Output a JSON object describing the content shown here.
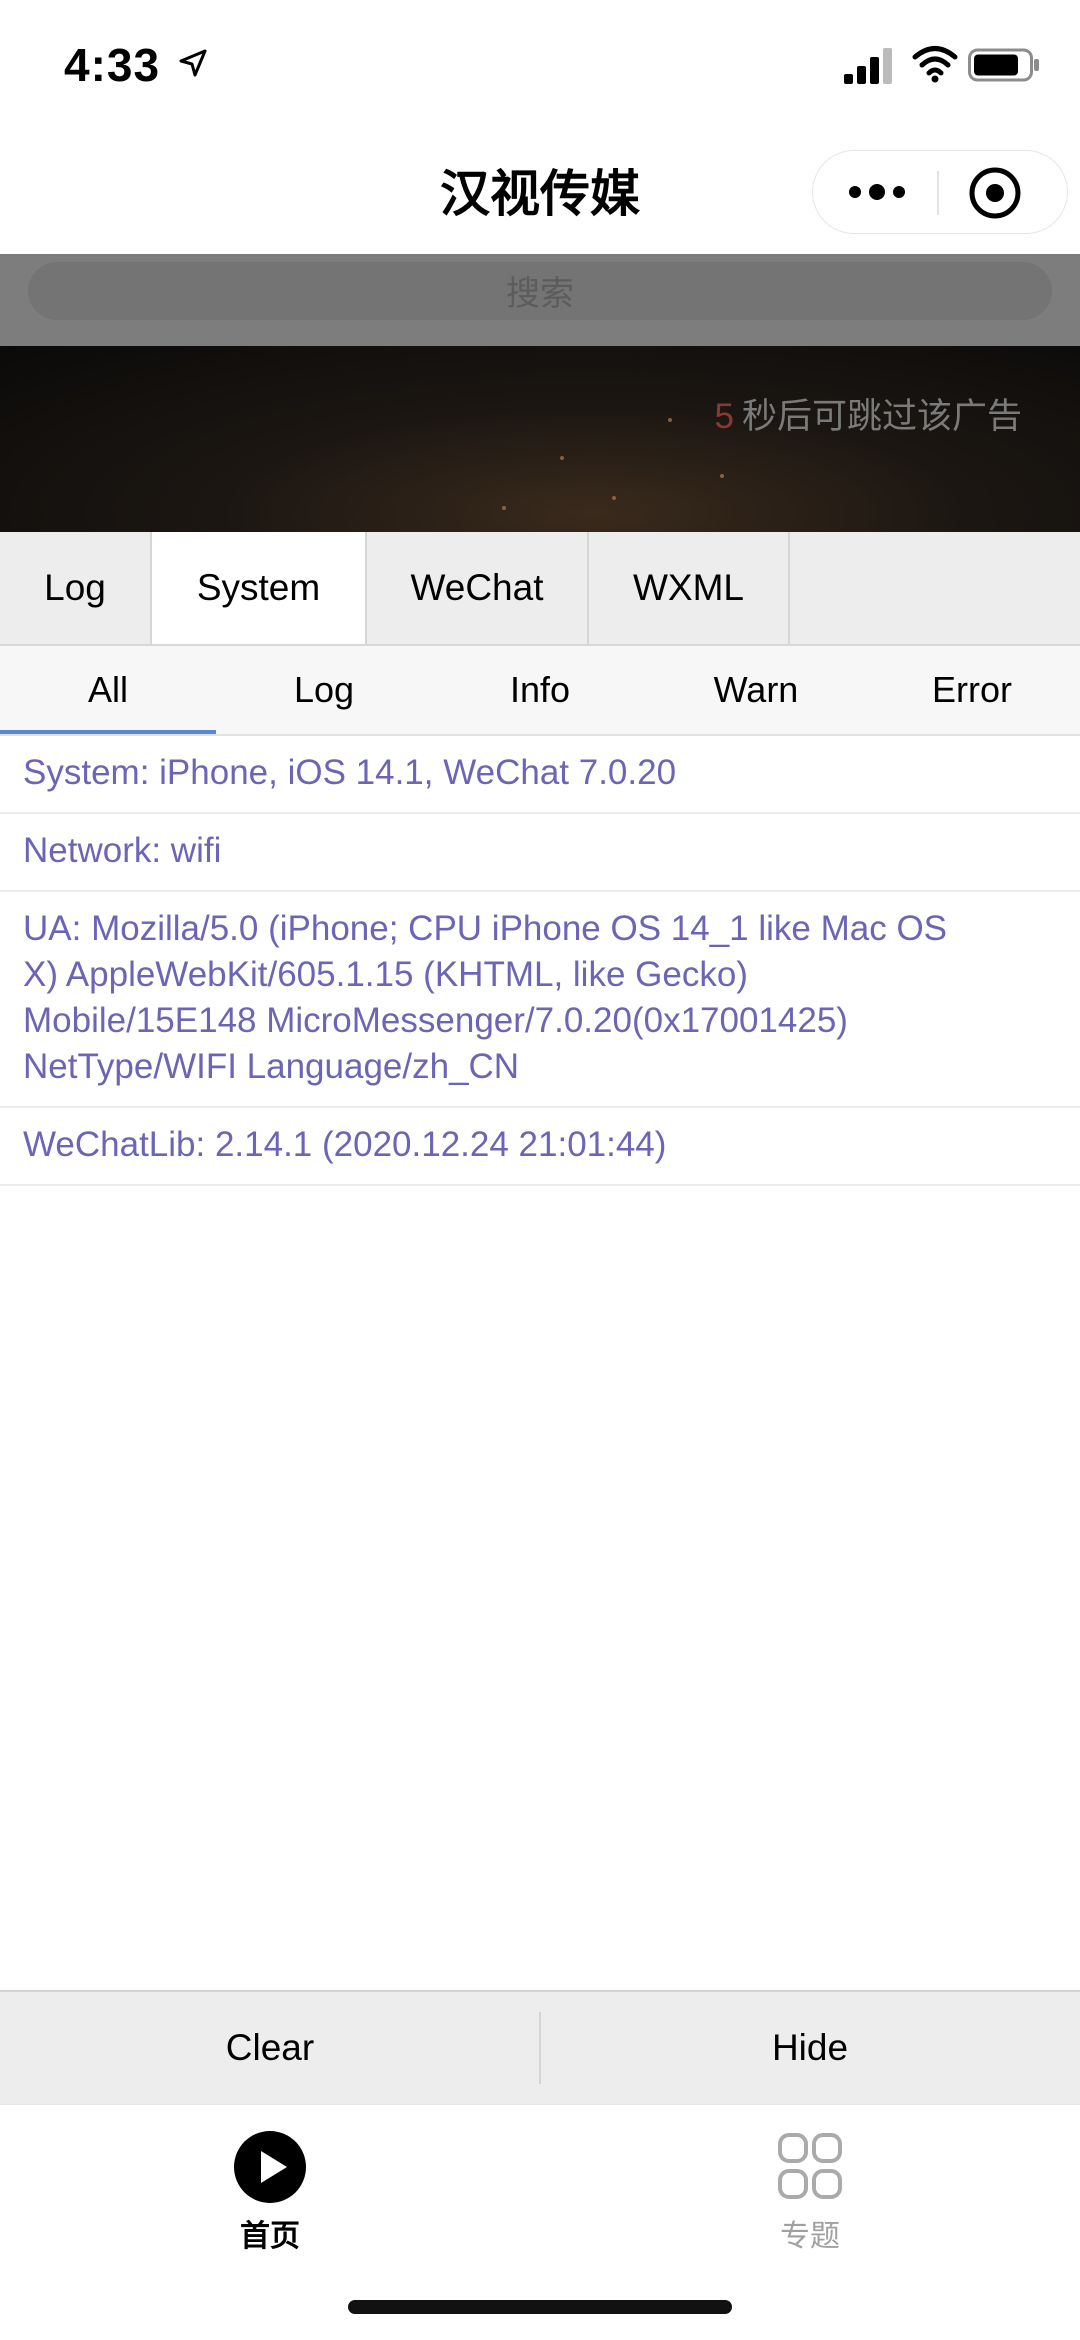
{
  "status_bar": {
    "time": "4:33"
  },
  "nav": {
    "title": "汉视传媒"
  },
  "search": {
    "placeholder": "搜索"
  },
  "ad": {
    "countdown": "5",
    "skip_text": "秒后可跳过该广告"
  },
  "vconsole": {
    "tabs": [
      {
        "label": "Log"
      },
      {
        "label": "System"
      },
      {
        "label": "WeChat"
      },
      {
        "label": "WXML"
      }
    ],
    "active_tab": "System",
    "subtabs": [
      {
        "label": "All"
      },
      {
        "label": "Log"
      },
      {
        "label": "Info"
      },
      {
        "label": "Warn"
      },
      {
        "label": "Error"
      }
    ],
    "active_subtab": "All",
    "logs": [
      "System: iPhone, iOS 14.1, WeChat 7.0.20",
      "Network: wifi",
      "UA: Mozilla/5.0 (iPhone; CPU iPhone OS 14_1 like Mac OS X) AppleWebKit/605.1.15 (KHTML, like Gecko) Mobile/15E148 MicroMessenger/7.0.20(0x17001425) NetType/WIFI Language/zh_CN",
      "WeChatLib: 2.14.1 (2020.12.24 21:01:44)"
    ],
    "footer": {
      "clear_label": "Clear",
      "hide_label": "Hide"
    }
  },
  "tabbar": {
    "items": [
      {
        "label": "首页",
        "icon": "play-circle-icon",
        "active": true
      },
      {
        "label": "专题",
        "icon": "grid-icon",
        "active": false
      }
    ]
  },
  "colors": {
    "log_text": "#6c65b6",
    "subtab_indicator": "#5b87d7",
    "ad_countdown": "#8a3a34"
  }
}
